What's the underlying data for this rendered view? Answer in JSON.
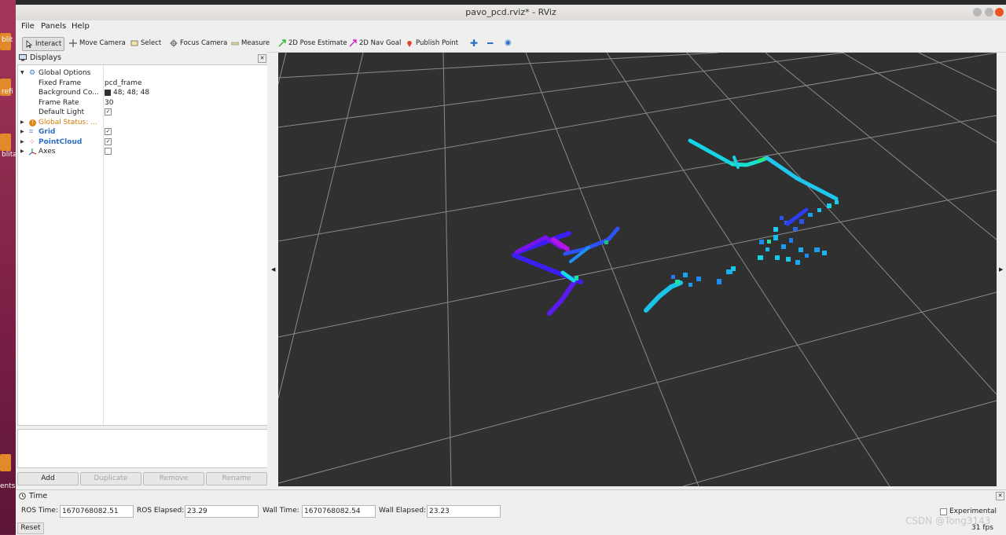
{
  "desktop": {
    "labels": [
      "blit",
      "refi",
      "blita",
      "ents"
    ]
  },
  "window": {
    "title": "pavo_pcd.rviz* - RViz"
  },
  "menu": [
    "File",
    "Panels",
    "Help"
  ],
  "toolbar": {
    "interact": "Interact",
    "move_camera": "Move Camera",
    "select": "Select",
    "focus_camera": "Focus Camera",
    "measure": "Measure",
    "pose_estimate": "2D Pose Estimate",
    "nav_goal": "2D Nav Goal",
    "publish_point": "Publish Point"
  },
  "displays": {
    "title": "Displays",
    "global_options": "Global Options",
    "fixed_frame_label": "Fixed Frame",
    "fixed_frame_value": "pcd_frame",
    "bg_color_label": "Background Co...",
    "bg_color_value": "48; 48; 48",
    "frame_rate_label": "Frame Rate",
    "frame_rate_value": "30",
    "default_light_label": "Default Light",
    "global_status": "Global Status: ...",
    "grid": "Grid",
    "pointcloud": "PointCloud",
    "axes": "Axes",
    "check": "✓",
    "buttons": {
      "add": "Add",
      "duplicate": "Duplicate",
      "remove": "Remove",
      "rename": "Rename"
    }
  },
  "time_panel": {
    "title": "Time",
    "ros_time_label": "ROS Time:",
    "ros_time": "1670768082.51",
    "ros_elapsed_label": "ROS Elapsed:",
    "ros_elapsed": "23.29",
    "wall_time_label": "Wall Time:",
    "wall_time": "1670768082.54",
    "wall_elapsed_label": "Wall Elapsed:",
    "wall_elapsed": "23.23",
    "experimental": "Experimental",
    "reset": "Reset",
    "fps": "31 fps"
  },
  "watermark": "CSDN @Tong3143",
  "colors": {
    "viewport_bg": "#303030",
    "grid_line": "#8a8a8a",
    "status_warn": "#d97b00",
    "link_blue": "#2d6fc2",
    "pointcloud_red": "#cc2020"
  }
}
